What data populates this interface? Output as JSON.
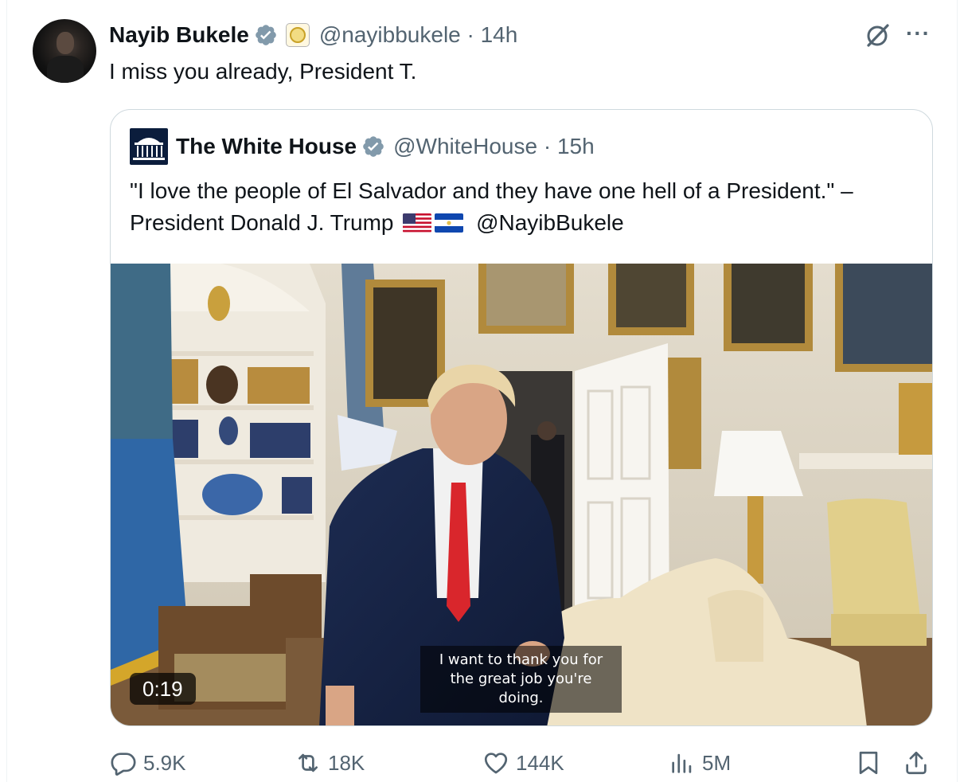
{
  "tweet": {
    "author_name": "Nayib Bukele",
    "handle_time": "@nayibbukele · 14h",
    "text": "I miss you already, President T."
  },
  "quoted": {
    "author_name": "The White House",
    "handle_time": "@WhiteHouse · 15h",
    "text_line1": "\"I love the people of El Salvador and they have one hell of a President.\" –",
    "text_line2_prefix": "President Donald J. Trump",
    "mention": "@NayibBukele",
    "video": {
      "duration": "0:19",
      "caption_line1": "I want to thank you for",
      "caption_line2": "the great job you're doing."
    }
  },
  "actions": {
    "replies": "5.9K",
    "reposts": "18K",
    "likes": "144K",
    "views": "5M"
  },
  "colors": {
    "verified": "#829aab",
    "secondary_text": "#536471",
    "border": "#cfd9de"
  },
  "icons": [
    "verified-badge-icon",
    "org-affiliation-icon",
    "grok-icon",
    "more-icon",
    "reply-icon",
    "repost-icon",
    "like-icon",
    "views-icon",
    "bookmark-icon",
    "share-icon"
  ]
}
